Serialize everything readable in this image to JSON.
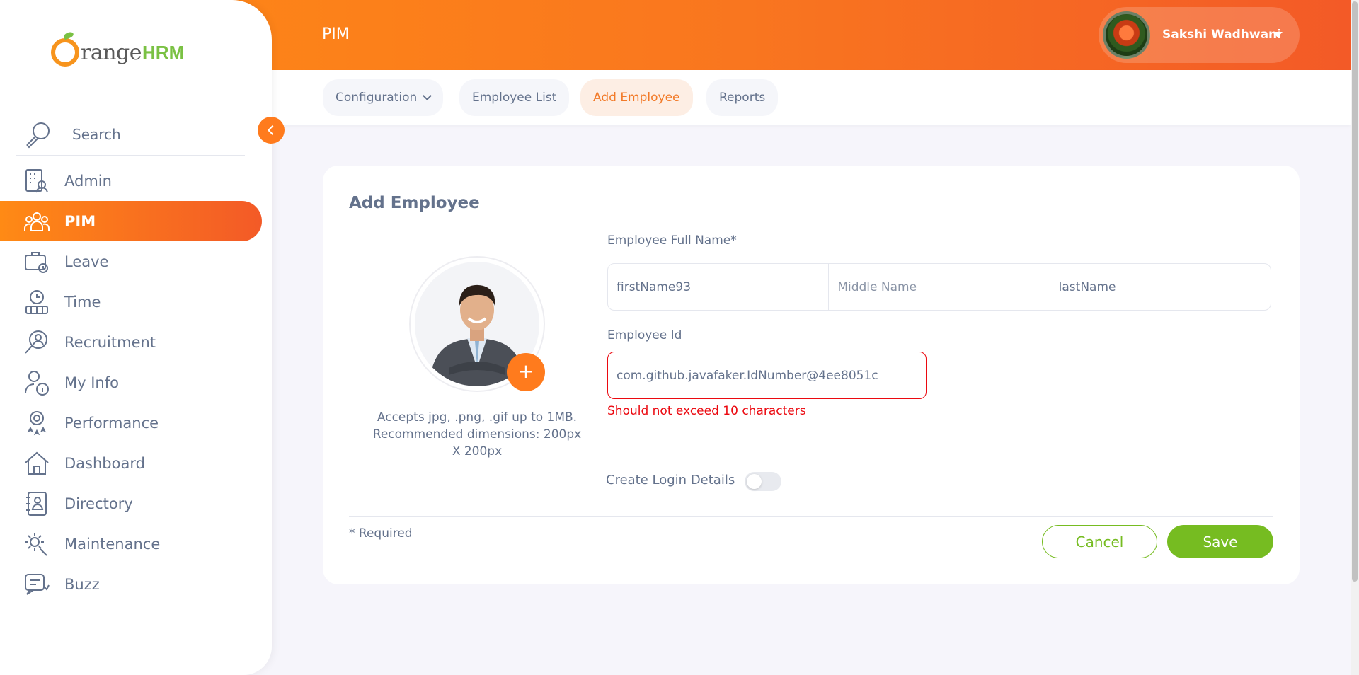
{
  "header": {
    "title": "PIM",
    "user_name": "Sakshi Wadhwani"
  },
  "topnav": {
    "tabs": [
      {
        "label": "Configuration",
        "has_dropdown": true,
        "active": false
      },
      {
        "label": "Employee List",
        "active": false
      },
      {
        "label": "Add Employee",
        "active": true
      },
      {
        "label": "Reports",
        "active": false
      }
    ]
  },
  "sidebar": {
    "logo_text": "range",
    "logo_suffix": "HRM",
    "search_label": "Search",
    "items": [
      {
        "label": "Admin",
        "icon": "admin-icon",
        "active": false
      },
      {
        "label": "PIM",
        "icon": "pim-icon",
        "active": true
      },
      {
        "label": "Leave",
        "icon": "leave-icon",
        "active": false
      },
      {
        "label": "Time",
        "icon": "time-icon",
        "active": false
      },
      {
        "label": "Recruitment",
        "icon": "recruitment-icon",
        "active": false
      },
      {
        "label": "My Info",
        "icon": "my-info-icon",
        "active": false
      },
      {
        "label": "Performance",
        "icon": "performance-icon",
        "active": false
      },
      {
        "label": "Dashboard",
        "icon": "dashboard-icon",
        "active": false
      },
      {
        "label": "Directory",
        "icon": "directory-icon",
        "active": false
      },
      {
        "label": "Maintenance",
        "icon": "maintenance-icon",
        "active": false
      },
      {
        "label": "Buzz",
        "icon": "buzz-icon",
        "active": false
      }
    ]
  },
  "form": {
    "title": "Add Employee",
    "photo_plus": "+",
    "photo_hint_line1": "Accepts jpg, .png, .gif up to 1MB.",
    "photo_hint_line2": "Recommended dimensions: 200px X 200px",
    "full_name_label": "Employee Full Name*",
    "first_name_value": "firstName93",
    "middle_name_placeholder": "Middle Name",
    "last_name_value": "lastName",
    "employee_id_label": "Employee Id",
    "employee_id_value": "com.github.javafaker.IdNumber@4ee8051c",
    "employee_id_error": "Should not exceed 10 characters",
    "create_login_label": "Create Login Details",
    "create_login_enabled": false,
    "required_note": "* Required",
    "cancel_label": "Cancel",
    "save_label": "Save"
  },
  "colors": {
    "brand_orange": "#ff7b1d",
    "brand_green": "#76bc21",
    "error_red": "#eb0910",
    "text_gray": "#64728c"
  }
}
